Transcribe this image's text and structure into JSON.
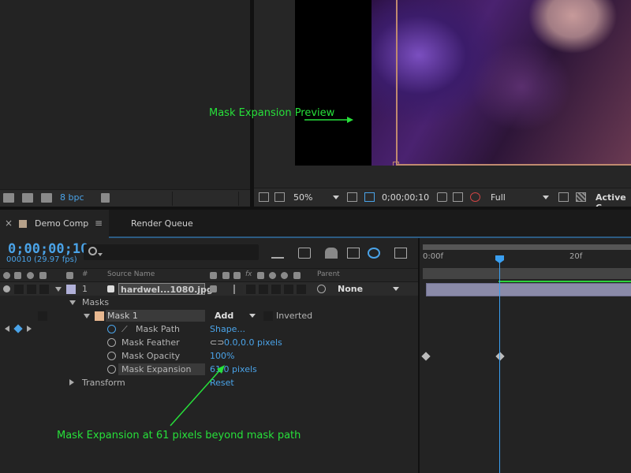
{
  "project": {
    "bit_depth": "8 bpc"
  },
  "viewer": {
    "zoom": "50%",
    "timecode": "0;00;00;10",
    "resolution": "Full",
    "camera": "Active C"
  },
  "tabs": {
    "comp": "Demo Comp",
    "render_queue": "Render Queue"
  },
  "timeline": {
    "timecode": "0;00;00;10",
    "frame_info": "00010 (29.97 fps)",
    "headers": {
      "source_name": "Source Name",
      "parent": "Parent",
      "fx": "fx"
    },
    "layer": {
      "number": "1",
      "name": "hardwel...1080.jpg",
      "parent": "None"
    },
    "masks_label": "Masks",
    "mask": {
      "name": "Mask 1",
      "mode": "Add",
      "inverted_label": "Inverted"
    },
    "properties": [
      {
        "name": "Mask Path",
        "value": "Shape..."
      },
      {
        "name": "Mask Feather",
        "value": "0.0,0.0 pixels"
      },
      {
        "name": "Mask Opacity",
        "value": "100%"
      },
      {
        "name": "Mask Expansion",
        "value": "61.0 pixels"
      }
    ],
    "transform_label": "Transform",
    "transform_value": "Reset",
    "ruler": {
      "start": "0:00f",
      "mark": "20f"
    }
  },
  "annotations": {
    "preview": "Mask Expansion Preview",
    "expansion": "Mask Expansion at 61 pixels beyond mask path"
  },
  "colors": {
    "accent_blue": "#4aa3e8",
    "annotation_green": "#27e03a",
    "mask_outline": "#c08a70"
  }
}
